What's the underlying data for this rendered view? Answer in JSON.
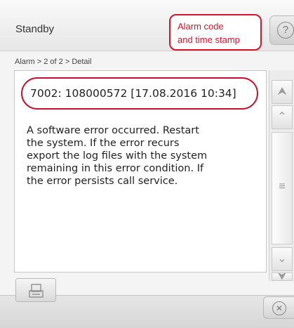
{
  "header": {
    "title": "Standby",
    "help_icon": "question-circle-icon"
  },
  "callout": {
    "line1": "Alarm code",
    "line2": "and time stamp",
    "color": "#d4162b"
  },
  "breadcrumb": "Alarm > 2 of 2 > Detail",
  "alarm": {
    "code_line": "7002: 108000572 [17.08.2016 10:34]",
    "message_lines": [
      "A software error occurred. Restart",
      "the system. If the error recurs",
      "export the log files with the system",
      "remaining in this error condition. If",
      "the error persists call service."
    ]
  },
  "scrollbar": {
    "top_icon": "double-chevron-up-icon",
    "up_icon": "chevron-up-icon",
    "thumb_icon": "grip-lines-icon",
    "down_icon": "chevron-down-icon",
    "bottom_icon": "double-chevron-down-icon"
  },
  "footer": {
    "print_icon": "printer-icon",
    "close_icon": "close-circle-icon"
  }
}
